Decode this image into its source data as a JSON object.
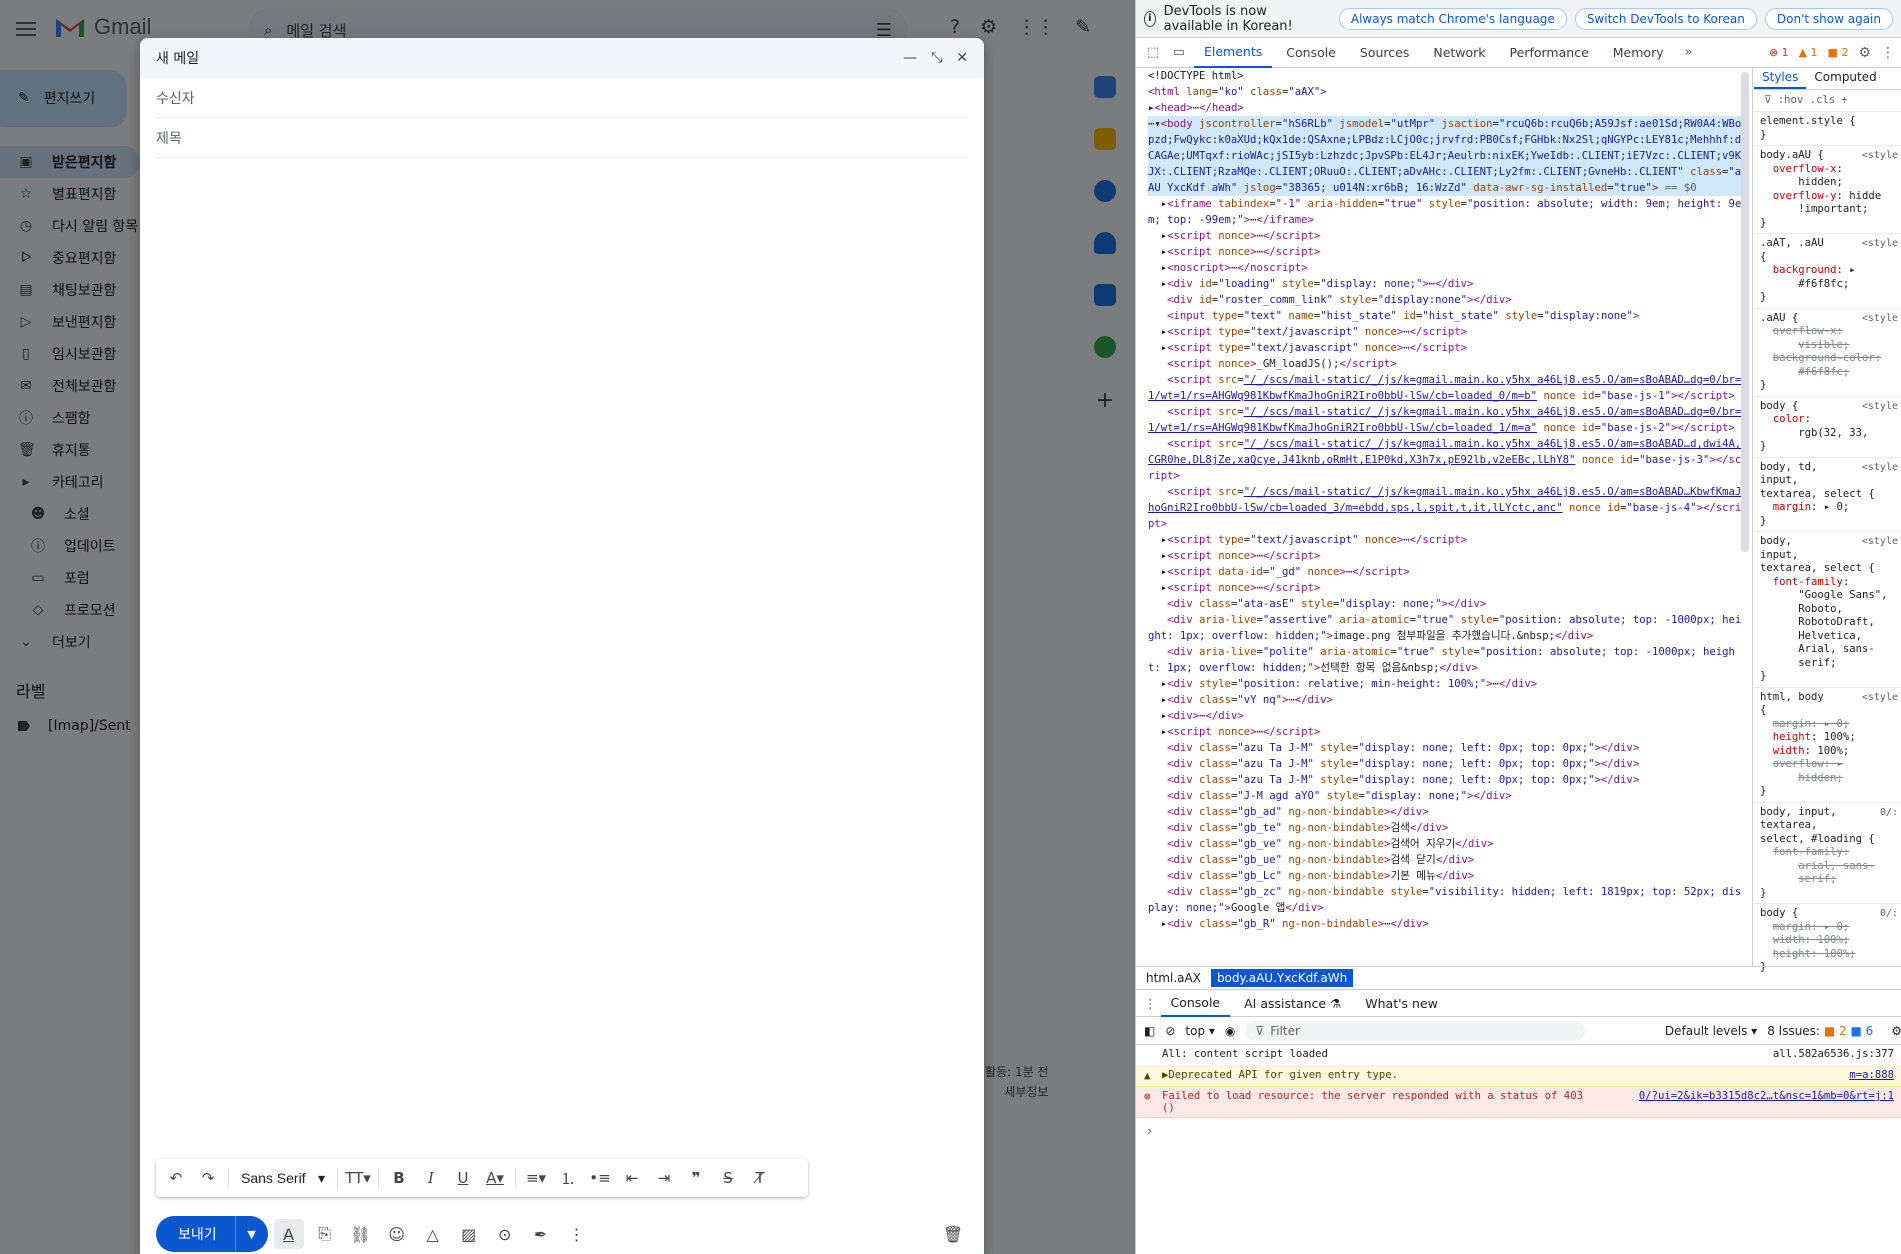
{
  "gmail": {
    "logo_text": "Gmail",
    "search_placeholder": "메일 검색",
    "compose_label": "편지쓰기",
    "nav": [
      {
        "icon": "inbox-icon",
        "glyph": "▣",
        "label": "받은편지함",
        "active": true
      },
      {
        "icon": "star-icon",
        "glyph": "☆",
        "label": "별표편지함"
      },
      {
        "icon": "clock-icon",
        "glyph": "◷",
        "label": "다시 알림 항목"
      },
      {
        "icon": "important-icon",
        "glyph": "ᐅ",
        "label": "중요편지함"
      },
      {
        "icon": "chat-icon",
        "glyph": "▤",
        "label": "채팅보관함"
      },
      {
        "icon": "send-icon",
        "glyph": "▷",
        "label": "보낸편지함"
      },
      {
        "icon": "draft-icon",
        "glyph": "▯",
        "label": "임시보관함"
      },
      {
        "icon": "all-mail-icon",
        "glyph": "✉",
        "label": "전체보관함"
      },
      {
        "icon": "spam-icon",
        "glyph": "ⓘ",
        "label": "스팸함"
      },
      {
        "icon": "trash-icon",
        "glyph": "🗑",
        "label": "휴지통"
      },
      {
        "icon": "category-icon",
        "glyph": "▸",
        "label": "카테고리"
      },
      {
        "icon": "social-icon",
        "glyph": "☻",
        "label": "소셜",
        "sub": true
      },
      {
        "icon": "updates-icon",
        "glyph": "ⓘ",
        "label": "업데이트",
        "sub": true
      },
      {
        "icon": "forum-icon",
        "glyph": "▭",
        "label": "포럼",
        "sub": true
      },
      {
        "icon": "promo-icon",
        "glyph": "◇",
        "label": "프로모션",
        "sub": true
      },
      {
        "icon": "chevron-down-icon",
        "glyph": "⌄",
        "label": "더보기"
      }
    ],
    "labels_heading": "라벨",
    "label_item": "[Imap]/Sent",
    "activity_line1": "활동: 1분 전",
    "activity_line2": "세부정보"
  },
  "compose": {
    "title": "새 메일",
    "to_placeholder": "수신자",
    "subject_placeholder": "제목",
    "font_name": "Sans Serif",
    "send_label": "보내기"
  },
  "devtools": {
    "banner_text": "DevTools is now available in Korean!",
    "banner_buttons": [
      "Always match Chrome's language",
      "Switch DevTools to Korean",
      "Don't show again"
    ],
    "tabs": [
      "Elements",
      "Console",
      "Sources",
      "Network",
      "Performance",
      "Memory"
    ],
    "active_tab": "Elements",
    "errors": "1",
    "warnings": "1",
    "issues": "2",
    "styles_tabs": [
      "Styles",
      "Computed"
    ],
    "styles_filter": ":hov  .cls",
    "breadcrumbs": [
      "html.aAX",
      "body.aAU.YxcKdf.aWh"
    ],
    "drawer_tabs": [
      "Console",
      "AI assistance",
      "What's new"
    ],
    "context": "top",
    "filter_placeholder": "Filter",
    "levels": "Default levels",
    "issues_summary": "8 Issues:",
    "issues_warn": "2",
    "issues_info": "6",
    "console": [
      {
        "level": "info",
        "text": "All: content script loaded",
        "source": "all.582a6536.js:377"
      },
      {
        "level": "warn",
        "text": "▶Deprecated API for given entry type.",
        "source": "m=a:888"
      },
      {
        "level": "error",
        "text": "Failed to load resource: the server responded with a status of 403\n()",
        "source": "0/?ui=2&ik=b3315d8c2…t&nsc=1&mb=0&rt=j:1"
      }
    ]
  }
}
